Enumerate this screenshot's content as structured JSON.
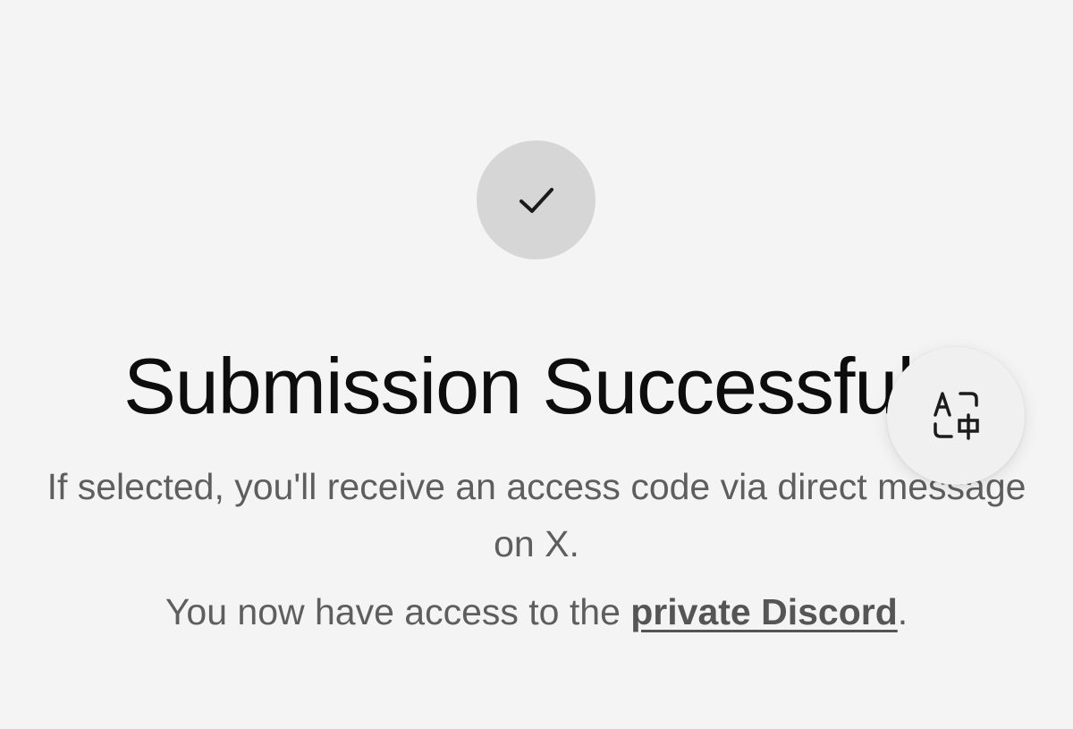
{
  "status": {
    "icon": "checkmark-icon"
  },
  "heading": {
    "title": "Submission Successful"
  },
  "message": {
    "description": "If selected, you'll receive an access code via direct message on X.",
    "discord_prefix": "You now have access to the ",
    "discord_link": "private Discord",
    "discord_suffix": "."
  },
  "floating_button": {
    "icon": "translate-icon"
  },
  "colors": {
    "background": "#f4f4f4",
    "circle": "#d6d6d6",
    "title": "#0d0d0d",
    "body_text": "#5e5e5e"
  }
}
